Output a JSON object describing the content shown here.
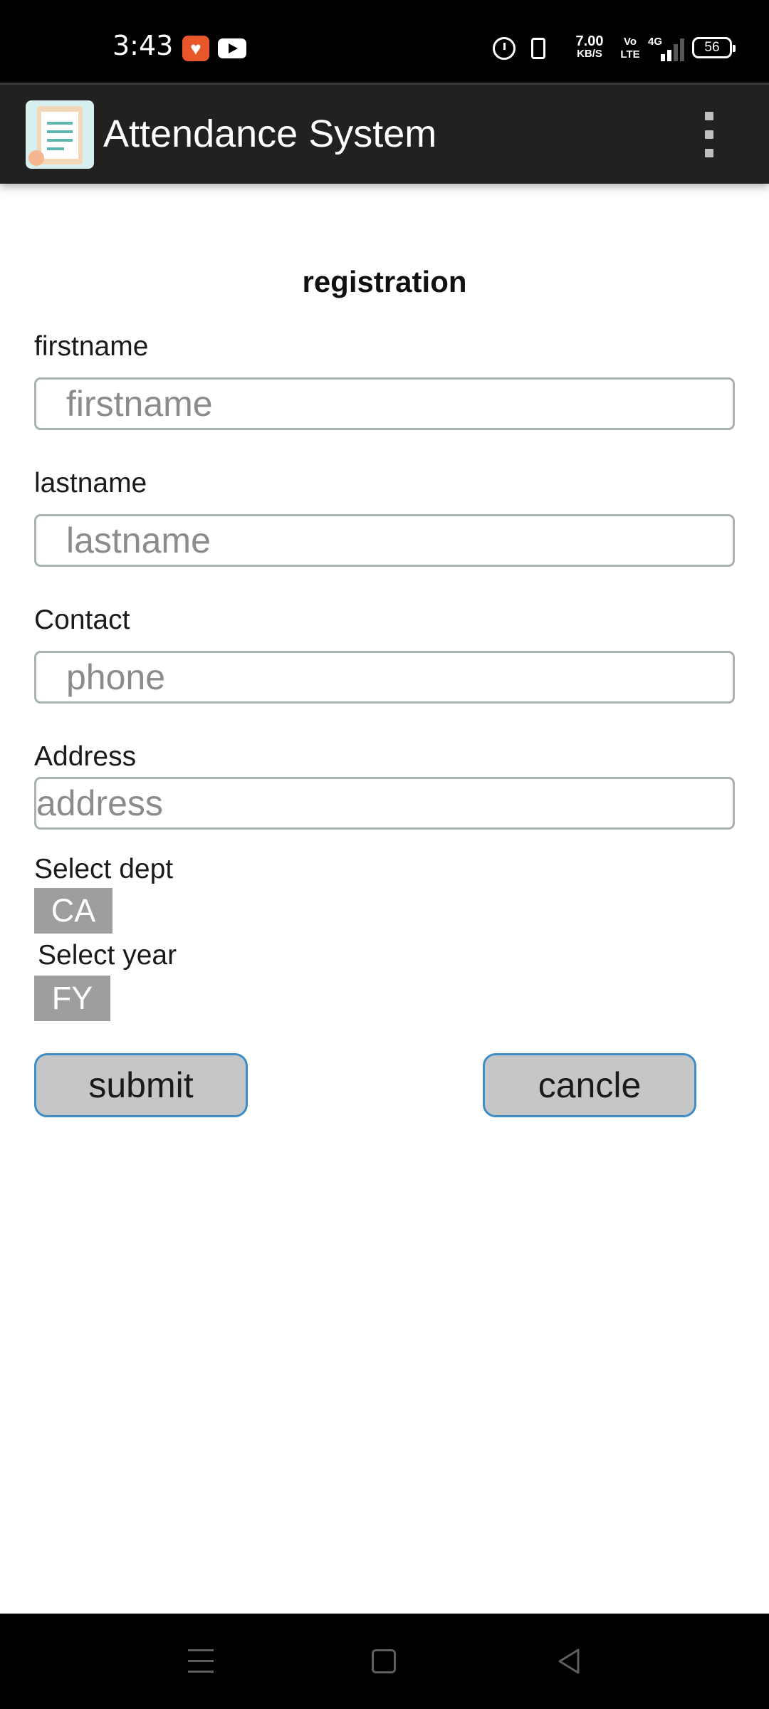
{
  "status_bar": {
    "time": "3:43",
    "net_speed_value": "7.00",
    "net_speed_unit": "KB/S",
    "volte": "Vo LTE",
    "network": "4G",
    "battery": "56",
    "icons": [
      "heart-notification-icon",
      "youtube-icon",
      "alarm-icon",
      "vibrate-icon",
      "signal-icon",
      "battery-icon"
    ]
  },
  "app_bar": {
    "title": "Attendance System",
    "logo_icon": "attendance-logo-icon",
    "menu_icon": "overflow-menu-icon"
  },
  "form": {
    "title": "registration",
    "firstname": {
      "label": "firstname",
      "placeholder": "firstname",
      "value": ""
    },
    "lastname": {
      "label": "lastname",
      "placeholder": "lastname",
      "value": ""
    },
    "contact": {
      "label": "Contact",
      "placeholder": "phone",
      "value": ""
    },
    "address": {
      "label": "Address",
      "placeholder": "address",
      "value": ""
    },
    "dept": {
      "label": "Select dept",
      "selected": "CA"
    },
    "year": {
      "label": "Select year",
      "selected": "FY"
    },
    "submit_label": "submit",
    "cancel_label": "cancle"
  },
  "colors": {
    "status_bar_bg": "#000000",
    "app_bar_bg": "#212121",
    "button_bg": "#c6c6c6",
    "button_border": "#3d8ec7",
    "spinner_bg": "#9e9e9e"
  }
}
